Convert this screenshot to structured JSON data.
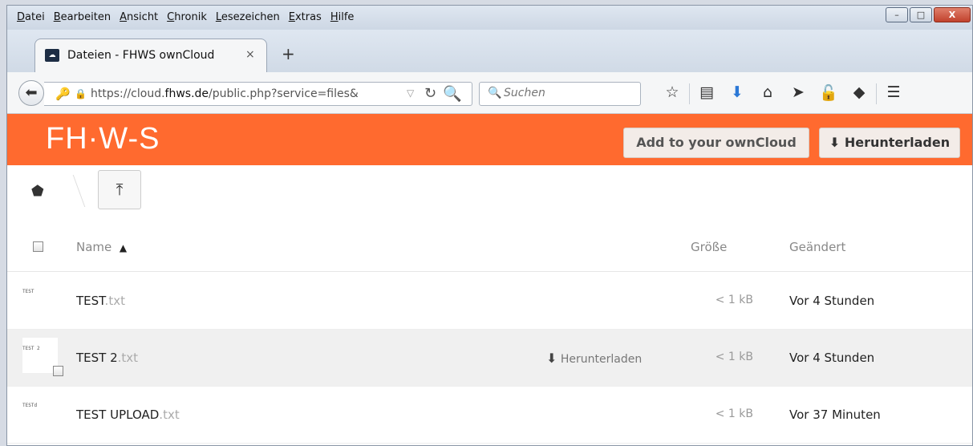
{
  "menubar": {
    "items": [
      "Datei",
      "Bearbeiten",
      "Ansicht",
      "Chronik",
      "Lesezeichen",
      "Extras",
      "Hilfe"
    ]
  },
  "window_controls": {
    "minimize": "–",
    "maximize": "□",
    "close": "X"
  },
  "tab": {
    "title": "Dateien - FHWS ownCloud",
    "close": "×",
    "new_tab": "+"
  },
  "navbar": {
    "url_prefix": "https://cloud.",
    "url_domain": "fhws.de",
    "url_suffix": "/public.php?service=files&",
    "search_placeholder": "Suchen"
  },
  "header": {
    "logo": "FH·W-S",
    "add_button": "Add to your ownCloud",
    "download_button": "Herunterladen",
    "brand_color": "#ff6a2f"
  },
  "files": {
    "columns": {
      "name": "Name",
      "sort_indicator": "▲",
      "size": "Größe",
      "modified": "Geändert"
    },
    "row_download_label": "Herunterladen",
    "rows": [
      {
        "thumb": "TEST",
        "base": "TEST",
        "ext": ".txt",
        "size": "< 1 kB",
        "modified": "Vor 4 Stunden"
      },
      {
        "thumb": "TEST 2",
        "base": "TEST 2",
        "ext": ".txt",
        "size": "< 1 kB",
        "modified": "Vor 4 Stunden"
      },
      {
        "thumb": "TESTd",
        "base": "TEST UPLOAD",
        "ext": ".txt",
        "size": "< 1 kB",
        "modified": "Vor 37 Minuten"
      }
    ]
  }
}
